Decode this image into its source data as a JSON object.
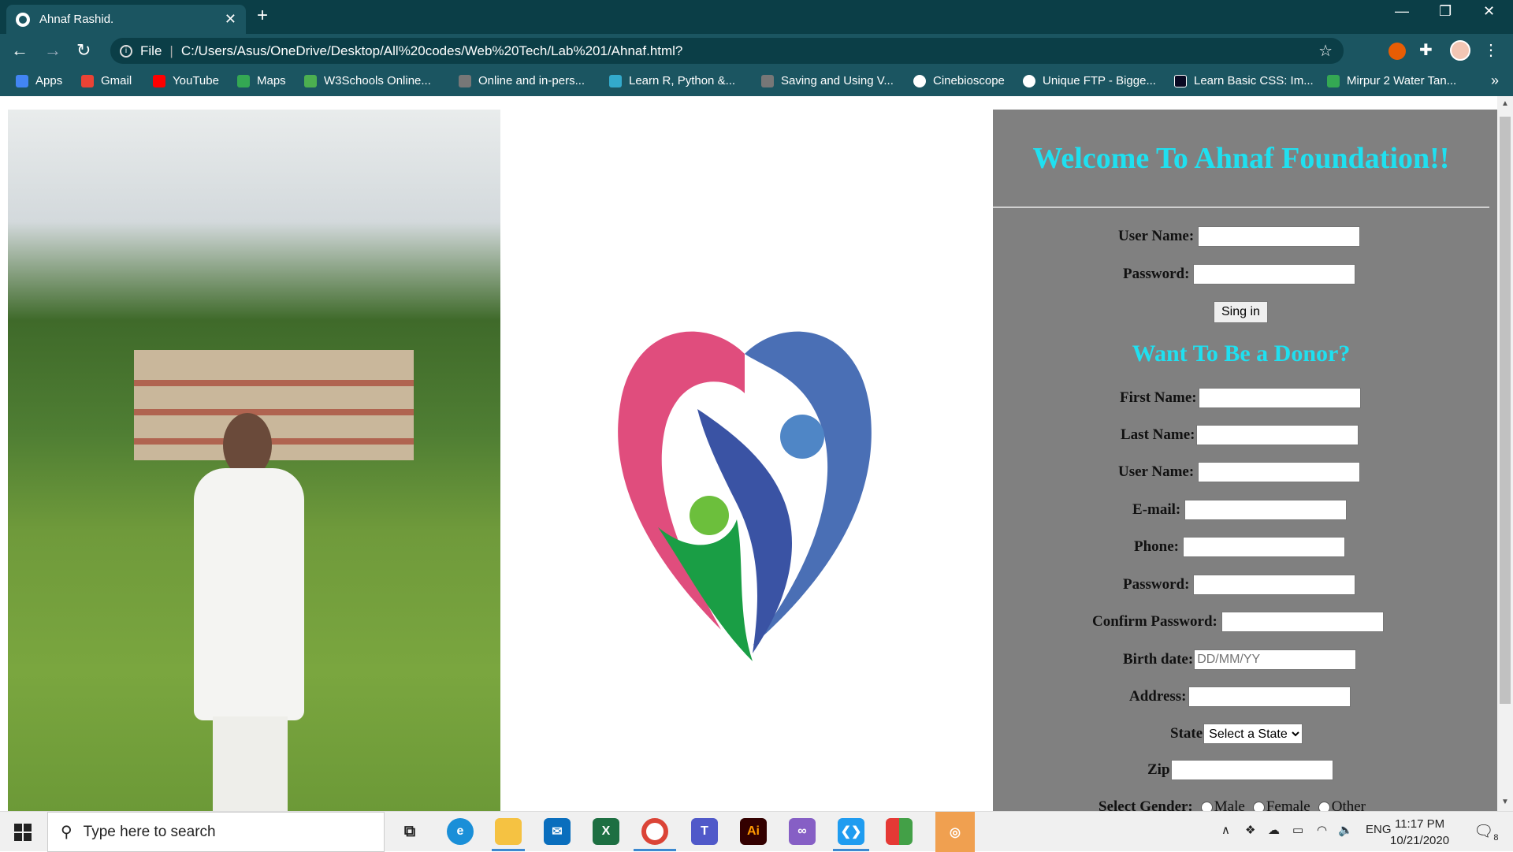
{
  "browser": {
    "tab_title": "Ahnaf Rashid.",
    "url_prefix": "File",
    "url": "C:/Users/Asus/OneDrive/Desktop/All%20codes/Web%20Tech/Lab%201/Ahnaf.html?",
    "bookmarks": [
      {
        "label": "Apps",
        "icon": "apps-grid-icon",
        "color": "#4285f4"
      },
      {
        "label": "Gmail",
        "icon": "gmail-icon",
        "color": "#ea4335"
      },
      {
        "label": "YouTube",
        "icon": "youtube-icon",
        "color": "#ff0000"
      },
      {
        "label": "Maps",
        "icon": "maps-icon",
        "color": "#34a853"
      },
      {
        "label": "W3Schools Online...",
        "icon": "w3schools-icon",
        "color": "#4caf50"
      },
      {
        "label": "Online and in-pers...",
        "icon": "web-icon",
        "color": "#777777"
      },
      {
        "label": "Learn R, Python &...",
        "icon": "datacamp-icon",
        "color": "#3ac"
      },
      {
        "label": "Saving and Using V...",
        "icon": "web-icon",
        "color": "#777777"
      },
      {
        "label": "Cinebioscope",
        "icon": "globe-icon",
        "color": "#ffffff"
      },
      {
        "label": "Unique FTP - Bigge...",
        "icon": "globe-icon",
        "color": "#ffffff"
      },
      {
        "label": "Learn Basic CSS: Im...",
        "icon": "freecodecamp-icon",
        "color": "#0a0a23"
      },
      {
        "label": "Mirpur 2 Water Tan...",
        "icon": "maps-icon",
        "color": "#34a853"
      }
    ]
  },
  "page": {
    "welcome": "Welcome To Ahnaf Foundation!!",
    "collapse_arrow": "<",
    "login": {
      "username_label": "User Name:",
      "password_label": "Password:",
      "signin_label": "Sing in"
    },
    "donor_title": "Want To Be a Donor?",
    "donor_form": {
      "first_name_label": "First Name:",
      "last_name_label": "Last Name:",
      "user_name_label": "User Name:",
      "email_label": "E-mail:",
      "phone_label": "Phone:",
      "password_label": "Password:",
      "confirm_password_label": "Confirm Password:",
      "birth_date_label": "Birth date:",
      "birth_date_placeholder": "DD/MM/YY",
      "address_label": "Address:",
      "state_label": "State",
      "state_selected": "Select a State",
      "zip_label": "Zip",
      "gender_label": "Select Gender:",
      "gender_options": [
        "Male",
        "Female",
        "Other"
      ]
    },
    "colors": {
      "title": "#1fe0f0",
      "sidebar_bg": "#808080"
    }
  },
  "taskbar": {
    "search_placeholder": "Type here to search",
    "language": "ENG",
    "time": "11:17 PM",
    "date": "10/21/2020",
    "notification_count": "8"
  }
}
